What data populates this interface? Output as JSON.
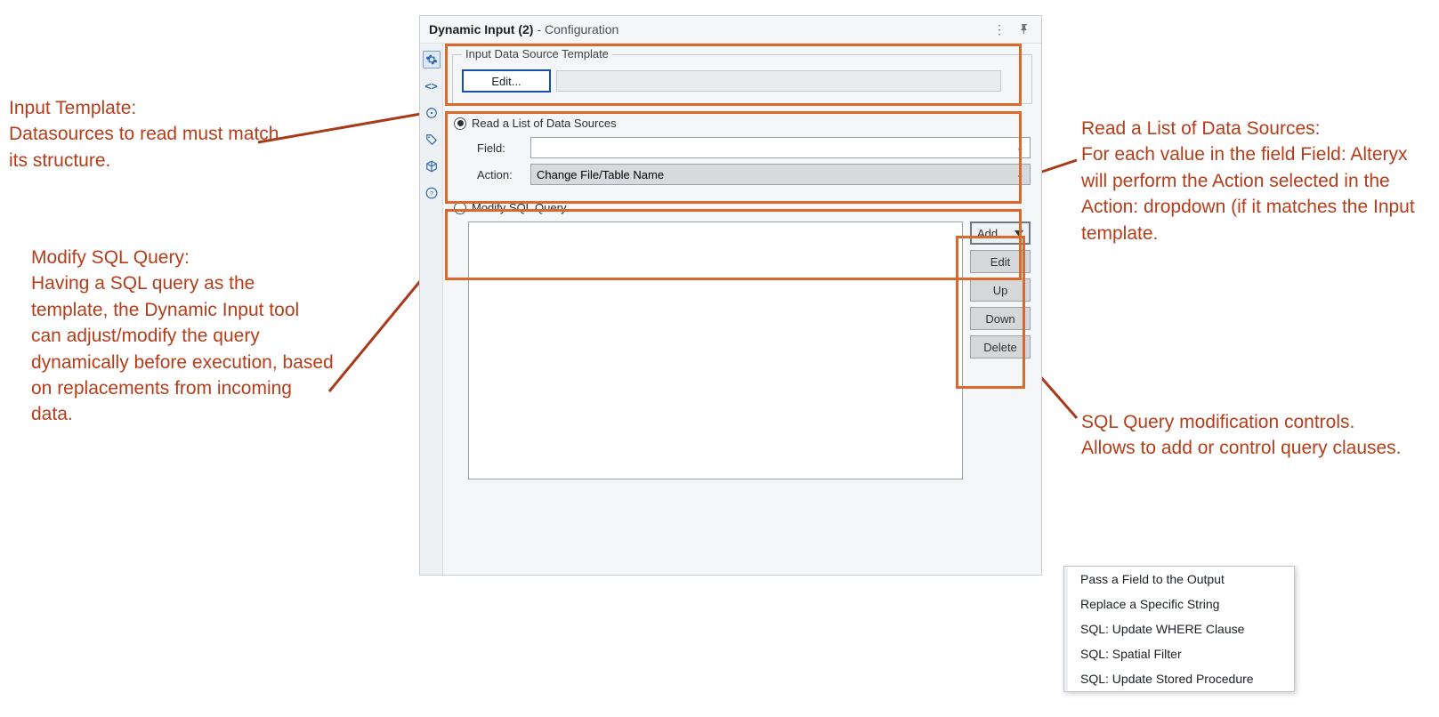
{
  "panel": {
    "title_bold": "Dynamic Input (2)",
    "title_light": " - Configuration"
  },
  "template_group": {
    "label": "Input Data Source Template",
    "edit_button": "Edit..."
  },
  "read_section": {
    "radio_label": "Read a List of Data Sources",
    "field_label": "Field:",
    "field_value": "",
    "action_label": "Action:",
    "action_value": "Change File/Table Name"
  },
  "modify_section": {
    "radio_label": "Modify SQL Query",
    "buttons": {
      "add": "Add",
      "edit": "Edit",
      "up": "Up",
      "down": "Down",
      "delete": "Delete"
    }
  },
  "annotations": {
    "left1": "Input Template:\nDatasources to read must match its structure.",
    "left2": "Modify SQL Query:\nHaving a SQL query as the template, the Dynamic Input tool can adjust/modify the query dynamically before execution, based on replacements from incoming data.",
    "right1": "Read a List of Data Sources:\nFor each value in the field Field: Alteryx will perform the Action selected in the Action: dropdown (if it matches the Input template.",
    "right2": "SQL Query modification controls.\nAllows to add or control query clauses."
  },
  "context_menu": {
    "items": [
      "Pass a Field to the Output",
      "Replace a Specific String",
      "SQL: Update WHERE Clause",
      "SQL: Spatial Filter",
      "SQL: Update Stored Procedure"
    ]
  }
}
